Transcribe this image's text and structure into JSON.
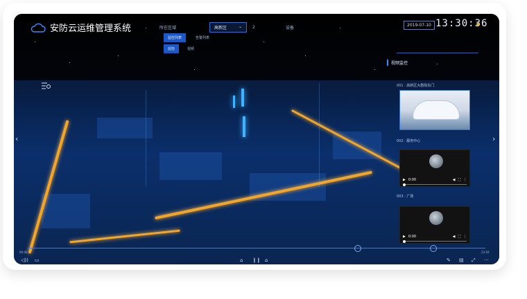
{
  "app": {
    "title": "安防云运维管理系统"
  },
  "header": {
    "area_label": "所在区域",
    "area_select": {
      "value": "高新区"
    },
    "num_label": "2",
    "right_label": "设备",
    "btn_active_1": "监控列表",
    "btn_link_1": "告警列表",
    "btn_active_2": "巡检",
    "btn_link_2": "视频",
    "date": "2019-07-10",
    "time": "13:30:36"
  },
  "right_panel": {
    "title": "视频监控",
    "cameras": [
      {
        "label": "001 · 高新区大剧院东门",
        "kind": "image"
      },
      {
        "label": "002 · 服务中心",
        "kind": "video",
        "time": "0:00"
      },
      {
        "label": "003 · 广场",
        "kind": "video",
        "time": "0:00"
      }
    ]
  },
  "timeline": {
    "start": "00:00",
    "end": "23:59",
    "progress": 0.72
  },
  "colors": {
    "accent": "#2d6ed2",
    "road": "#f3a52b",
    "tower": "#3fb3ff",
    "dot": "#e5a32c"
  },
  "icons": [
    "cloud-icon",
    "filter-icon",
    "chevron-left-icon",
    "chevron-right-icon",
    "play-icon",
    "volume-icon",
    "fullscreen-icon",
    "more-icon",
    "pen-icon",
    "layers-icon",
    "expand-icon",
    "dots-icon",
    "cone-icon",
    "pause-icon"
  ]
}
